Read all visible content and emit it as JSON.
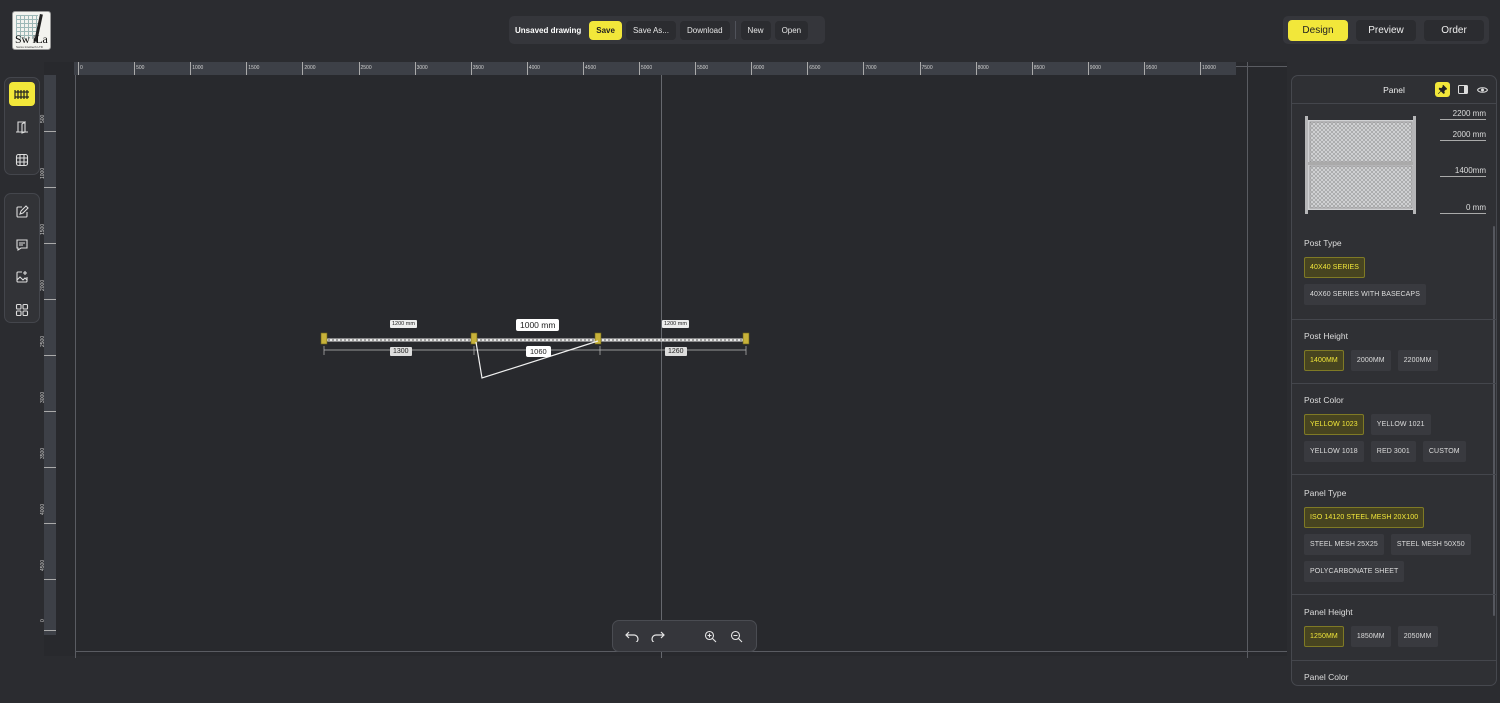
{
  "logo": {
    "text": "Sw iLa",
    "tagline": "Swiss Intelitech LTD"
  },
  "toolbar": {
    "status": "Unsaved drawing",
    "save": "Save",
    "save_as": "Save As...",
    "download": "Download",
    "new": "New",
    "open": "Open"
  },
  "modes": [
    "Design",
    "Preview",
    "Order"
  ],
  "left_tools": {
    "group1": [
      "fence-icon",
      "door-icon",
      "globe-icon"
    ],
    "group2": [
      "edit-icon",
      "comment-icon",
      "image-edit-icon",
      "grid-apps-icon"
    ]
  },
  "ruler": {
    "horizontal": [
      "0",
      "500",
      "1000",
      "1500",
      "2000",
      "2500",
      "3000",
      "3500",
      "4000",
      "4500",
      "5000",
      "5500",
      "6000",
      "6500",
      "7000",
      "7500",
      "8000",
      "8500",
      "9000",
      "9500",
      "10000"
    ],
    "vertical": [
      "500",
      "1000",
      "1500",
      "2000",
      "2500",
      "3000",
      "3500",
      "4000",
      "4500",
      "0"
    ]
  },
  "drawing": {
    "top_labels": [
      "1200 mm",
      "1000 mm",
      "1200 mm"
    ],
    "bottom_labels": [
      "1300",
      "1060",
      "1260"
    ]
  },
  "zoom_bar": [
    "undo-icon",
    "redo-icon",
    "zoom-in-icon",
    "zoom-out-icon"
  ],
  "panel": {
    "title": "Panel",
    "dims": [
      "2200 mm",
      "2000 mm",
      "1400mm",
      "0 mm"
    ],
    "sections": [
      {
        "title": "Post Type",
        "options": [
          "40X40 SERIES",
          "40X60 SERIES WITH BASECAPS"
        ],
        "selected": 0
      },
      {
        "title": "Post Height",
        "options": [
          "1400MM",
          "2000MM",
          "2200MM"
        ],
        "selected": 0
      },
      {
        "title": "Post Color",
        "options": [
          "YELLOW 1023",
          "YELLOW 1021",
          "YELLOW 1018",
          "RED 3001",
          "CUSTOM"
        ],
        "selected": 0
      },
      {
        "title": "Panel Type",
        "options": [
          "ISO 14120 STEEL MESH 20X100",
          "STEEL MESH 25X25",
          "STEEL MESH 50X50",
          "POLYCARBONATE SHEET"
        ],
        "selected": 0
      },
      {
        "title": "Panel Height",
        "options": [
          "1250MM",
          "1850MM",
          "2050MM"
        ],
        "selected": 0
      },
      {
        "title": "Panel Color",
        "options": [],
        "selected": -1
      }
    ]
  },
  "colors": {
    "accent": "#f2e73a",
    "background": "#2b2c30",
    "post": "#c8b23a"
  }
}
